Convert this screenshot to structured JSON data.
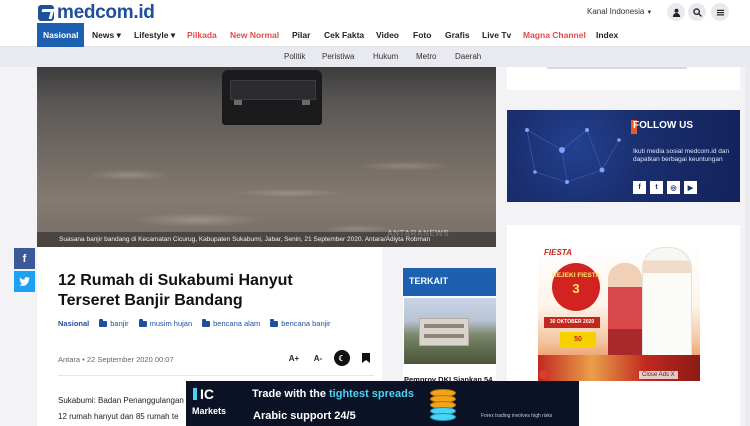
{
  "header": {
    "logo_text": "medcom.id",
    "kanal_label": "Kanal Indonesia",
    "icons": [
      "user-icon",
      "search-icon",
      "menu-icon"
    ]
  },
  "nav": {
    "items": [
      {
        "label": "Nasional",
        "active": true
      },
      {
        "label": "News ▾"
      },
      {
        "label": "Lifestyle ▾"
      },
      {
        "label": "Pilkada",
        "color": "#e34b4b"
      },
      {
        "label": "New Normal",
        "color": "#e34b4b"
      },
      {
        "label": "Pilar"
      },
      {
        "label": "Cek Fakta"
      },
      {
        "label": "Video"
      },
      {
        "label": "Foto"
      },
      {
        "label": "Grafis"
      },
      {
        "label": "Live Tv"
      },
      {
        "label": "Magna Channel",
        "color": "#e34b4b"
      },
      {
        "label": "Index"
      }
    ],
    "subnav": [
      "Politik",
      "Peristiwa",
      "Hukum",
      "Metro",
      "Daerah"
    ]
  },
  "hero": {
    "caption": "Suasana banjir bandang di Kecamatan Cicurug, Kabupaten Sukabumi, Jabar, Senin, 21 September 2020. Antara/Adiyta Robman",
    "watermark": "ANTARANEWS"
  },
  "share": {
    "facebook": "f",
    "twitter": "t"
  },
  "article": {
    "title": "12 Rumah di Sukabumi Hanyut Terseret Banjir Bandang",
    "category": "Nasional",
    "tags": [
      "banjir",
      "musim hujan",
      "bencana alam",
      "bencana banjir"
    ],
    "meta": "Antara • 22 September 2020 00:07",
    "tools": [
      "A+",
      "A-",
      "☾",
      "⚑"
    ],
    "body_lines": [
      "Sukabumi: Badan Penanggulangan",
      "12 rumah hanyut dan 85 rumah te"
    ]
  },
  "terkait": {
    "label": "TERKAIT",
    "item_title": "Pemprov DKI Siapkan 54"
  },
  "follow": {
    "title": "FOLLOW US",
    "description": "Ikuti media sosial medcom.id dan dapatkan berbagai keuntungan",
    "socials": [
      "f",
      "t",
      "◎",
      "▶"
    ]
  },
  "ad": {
    "brand": "FIESTA",
    "circle_label": "REJEKI FIESTA",
    "circle_num": "3",
    "date": "30 OKTOBER 2020",
    "badge": "50",
    "close_label": "Close Ads X"
  },
  "bottom_ad": {
    "logo_top": "IC",
    "logo_bottom": "Markets",
    "headline_pre": "Trade with the ",
    "headline_hl": "tightest spreads",
    "sub": "Arabic support 24/5",
    "risk": "Forex trading involves high risks"
  },
  "colors": {
    "brand": "#1d4f9c",
    "nav_active": "#1d60b0",
    "accent_red": "#e34b4b",
    "accent_orange": "#e85a2a"
  }
}
